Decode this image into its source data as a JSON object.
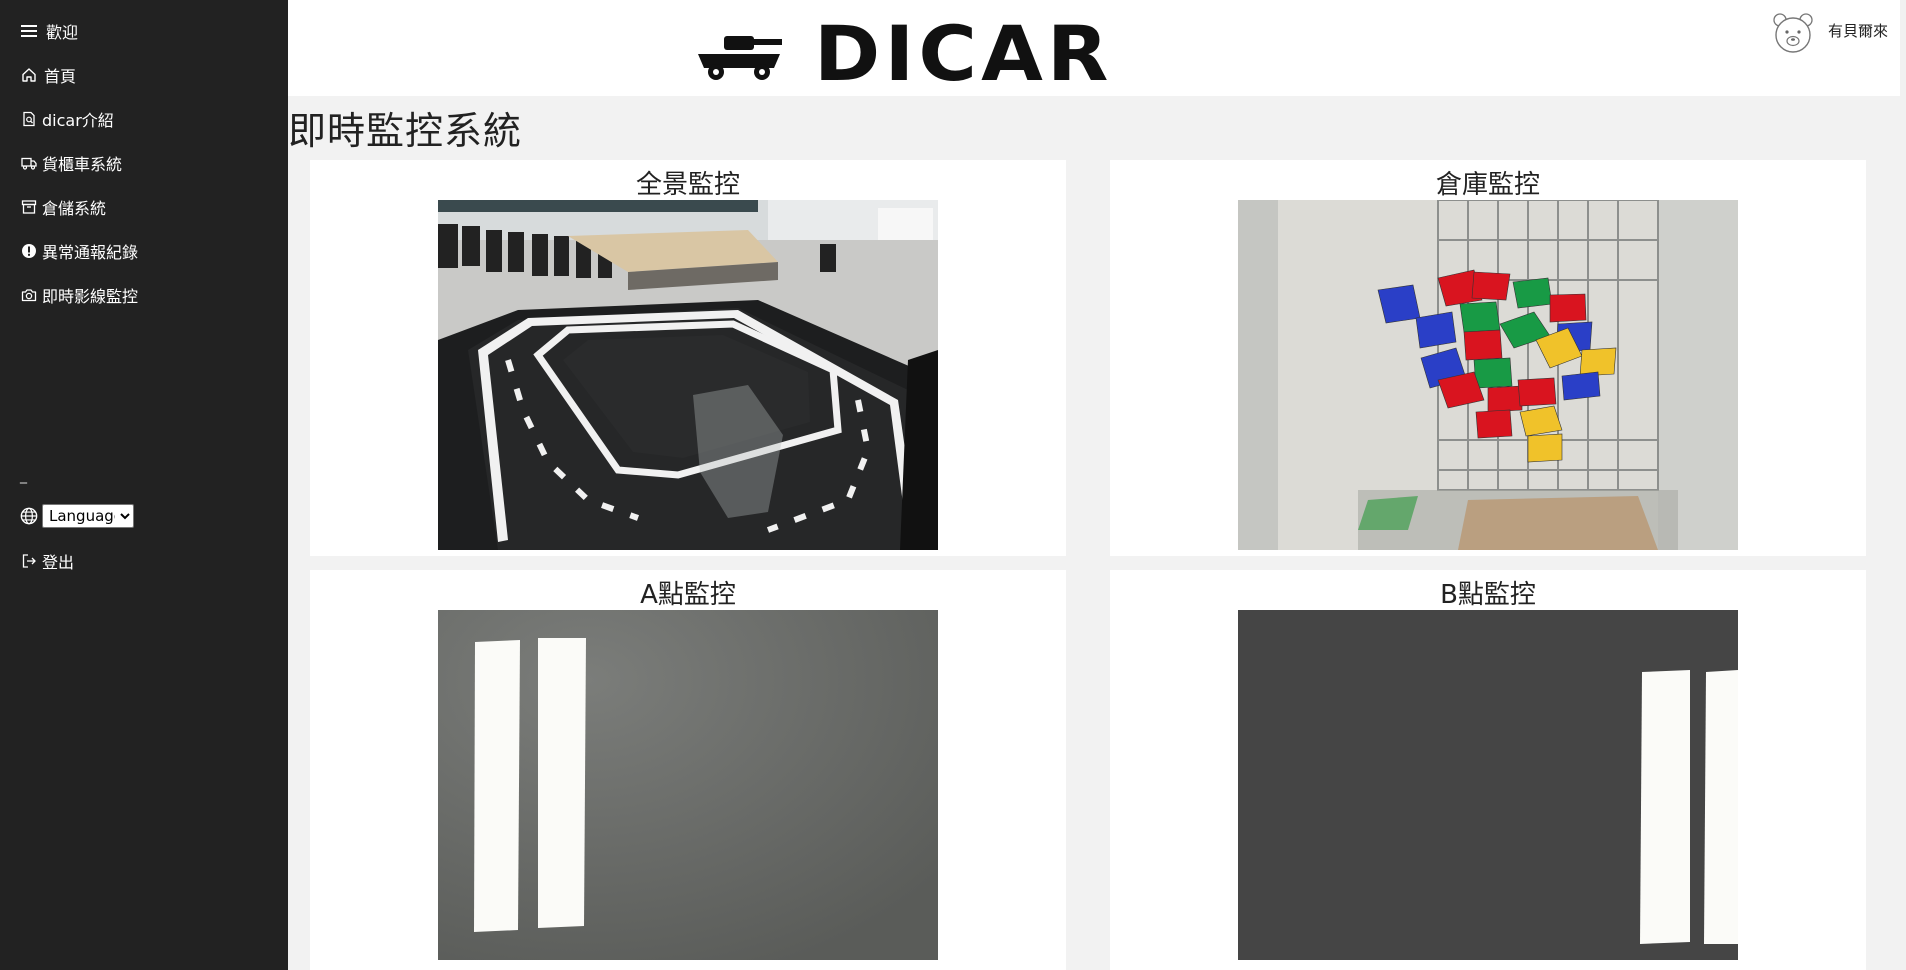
{
  "sidebar": {
    "welcome": "歡迎",
    "items": [
      {
        "label": "首頁",
        "icon": "house-icon"
      },
      {
        "label": "dicar介紹",
        "icon": "search-doc-icon"
      },
      {
        "label": "貨櫃車系統",
        "icon": "truck-icon"
      },
      {
        "label": "倉儲系統",
        "icon": "archive-icon"
      },
      {
        "label": "異常通報紀錄",
        "icon": "exclamation-circle-icon"
      },
      {
        "label": "即時影線監控",
        "icon": "camera-icon"
      }
    ],
    "separator": "_",
    "language": {
      "selected": "Language",
      "options": [
        "Language"
      ]
    },
    "logout": "登出"
  },
  "header": {
    "logo_text": "DICAR",
    "username": "有貝爾來"
  },
  "page": {
    "title": "即時監控系統"
  },
  "monitors": [
    {
      "title": "全景監控"
    },
    {
      "title": "倉庫監控"
    },
    {
      "title": "A點監控"
    },
    {
      "title": "B點監控"
    }
  ],
  "colors": {
    "sidebar_bg": "#222222",
    "page_bg": "#f2f2f2",
    "card_bg": "#ffffff"
  }
}
